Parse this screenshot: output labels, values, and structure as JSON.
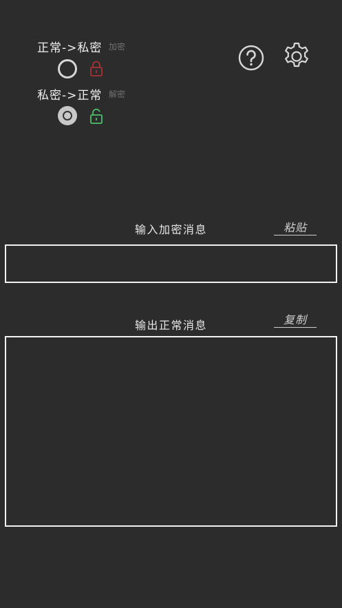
{
  "modes": {
    "encrypt": {
      "label": "正常->私密",
      "sub": "加密",
      "selected": false,
      "lock_color": "#a83232",
      "icon": "lock-closed-icon"
    },
    "decrypt": {
      "label": "私密->正常",
      "sub": "解密",
      "selected": true,
      "lock_color": "#4cc26a",
      "icon": "lock-open-icon"
    }
  },
  "toolbar": {
    "help_icon": "help-icon",
    "settings_icon": "gear-icon"
  },
  "input": {
    "label": "输入加密消息",
    "action": "粘贴",
    "value": ""
  },
  "output": {
    "label": "输出正常消息",
    "action": "复制",
    "value": ""
  },
  "colors": {
    "background": "#2c2c2c",
    "border": "#f2f2f2"
  }
}
